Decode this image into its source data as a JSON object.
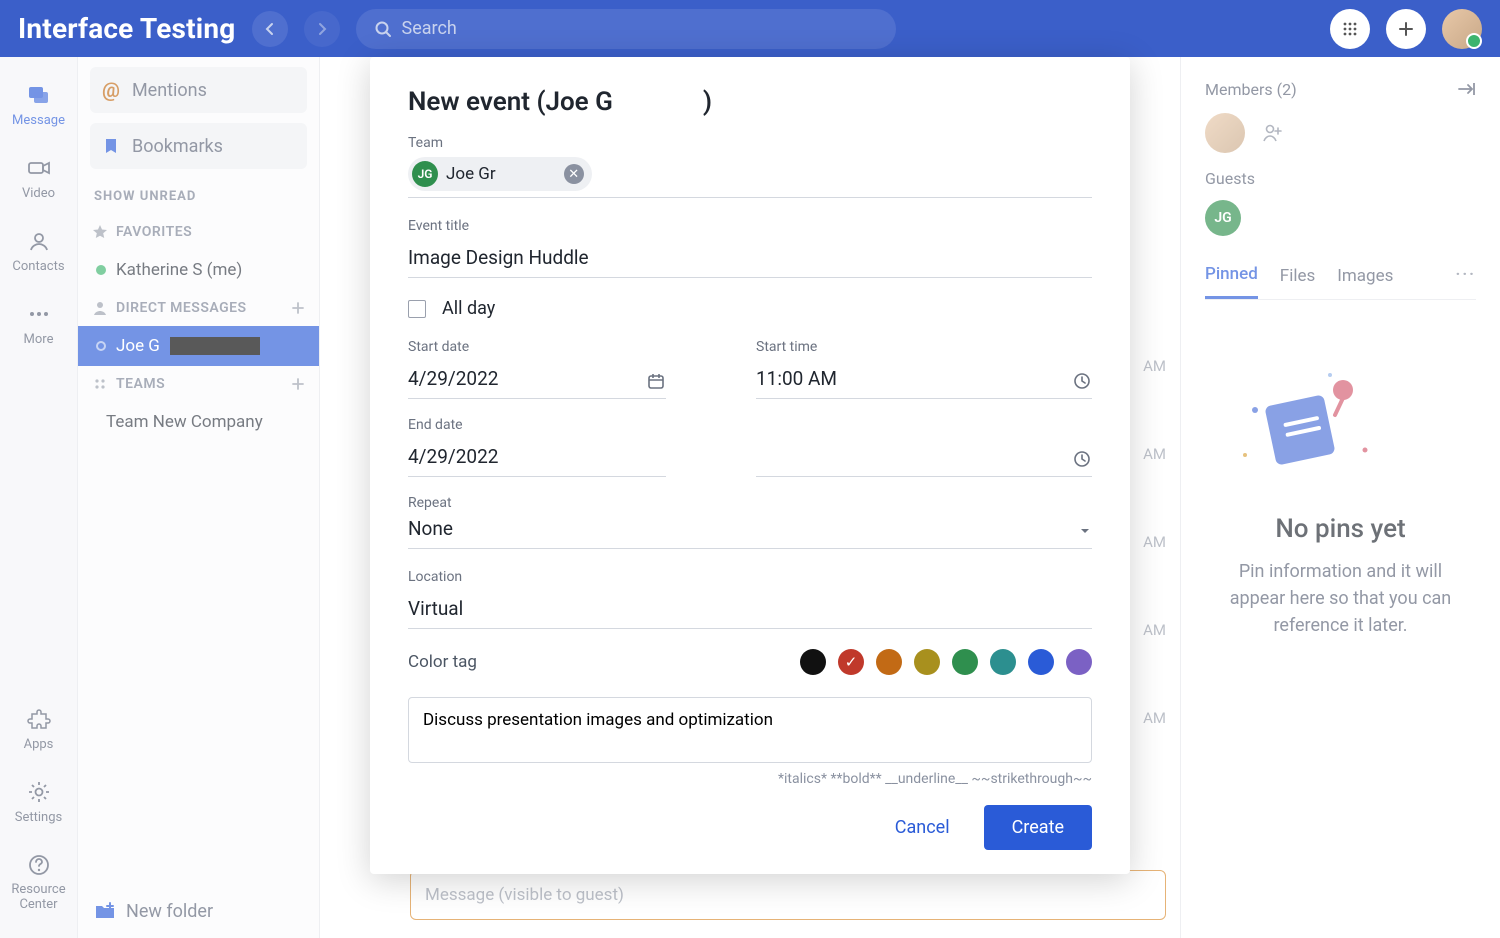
{
  "topbar": {
    "brand": "Interface Testing",
    "search_placeholder": "Search"
  },
  "rail": {
    "items": [
      {
        "label": "Message"
      },
      {
        "label": "Video"
      },
      {
        "label": "Contacts"
      },
      {
        "label": "More"
      }
    ],
    "bottom": [
      {
        "label": "Apps"
      },
      {
        "label": "Settings"
      },
      {
        "label": "Resource Center"
      }
    ]
  },
  "sidebar": {
    "mentions": "Mentions",
    "bookmarks": "Bookmarks",
    "show_unread": "SHOW UNREAD",
    "favorites_label": "FAVORITES",
    "favorites": [
      {
        "label": "Katherine S (me)",
        "dot": "#3cb46e"
      }
    ],
    "dm_label": "DIRECT MESSAGES",
    "dms": [
      {
        "label": "Joe G",
        "masked": true
      }
    ],
    "teams_label": "TEAMS",
    "teams": [
      {
        "label": "Team New Company"
      }
    ],
    "new_folder": "New folder"
  },
  "members_panel": {
    "header": "Members (2)",
    "guests_label": "Guests",
    "guest_initials": "JG",
    "tabs": [
      "Pinned",
      "Files",
      "Images"
    ],
    "empty_title": "No pins yet",
    "empty_body": "Pin information and it will appear here so that you can reference it later."
  },
  "center": {
    "times": [
      "AM",
      "AM",
      "AM",
      "AM",
      "AM"
    ],
    "message_placeholder": "Message (visible to guest)"
  },
  "modal": {
    "title_prefix": "New event (Joe G",
    "title_suffix": ")",
    "team_label": "Team",
    "team_chip_initials": "JG",
    "team_chip_name": "Joe Gr",
    "event_title_label": "Event title",
    "event_title_value": "Image Design Huddle",
    "all_day": "All day",
    "start_date_label": "Start date",
    "start_date_value": "4/29/2022",
    "start_time_label": "Start time",
    "start_time_value": "11:00 AM",
    "end_date_label": "End date",
    "end_date_value": "4/29/2022",
    "end_time_value": "",
    "repeat_label": "Repeat",
    "repeat_value": "None",
    "location_label": "Location",
    "location_value": "Virtual",
    "color_tag_label": "Color tag",
    "colors": [
      "#111111",
      "#c0392b",
      "#c26a15",
      "#a8901e",
      "#2f8f4e",
      "#2c8f8f",
      "#2a5bd7",
      "#7b61c4"
    ],
    "color_selected_index": 1,
    "description_value": "Discuss presentation images and optimization",
    "format_hint": "*italics* **bold** __underline__ ~~strikethrough~~",
    "cancel": "Cancel",
    "create": "Create"
  }
}
